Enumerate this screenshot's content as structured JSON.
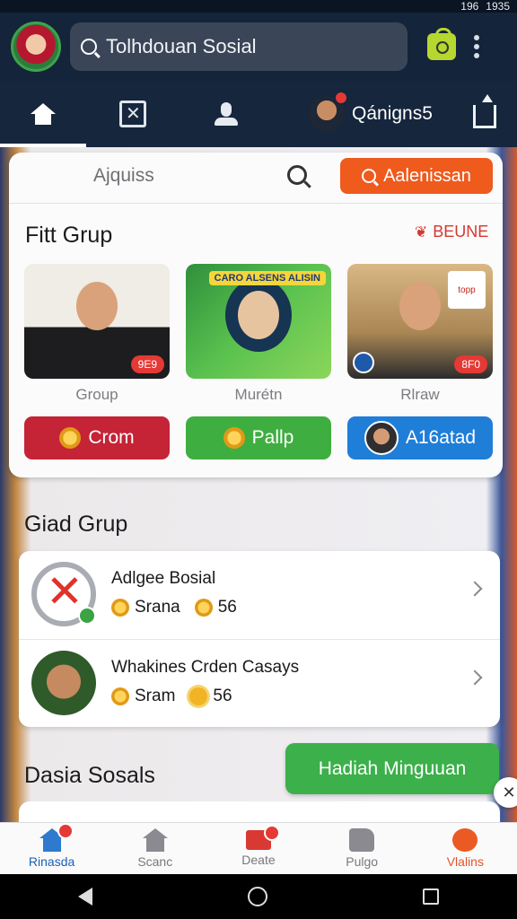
{
  "status_bar": {
    "battery": "196",
    "time": "1935"
  },
  "header": {
    "search_text": "Tolhdouan Sosial"
  },
  "nav_tabs": {
    "profile_name": "Qánigns5"
  },
  "featured": {
    "search_label": "Ajquiss",
    "action_button": "Aalenissan",
    "section_title": "Fitt Grup",
    "see_more": "BEUNE",
    "thumbnails": [
      {
        "caption": "Group",
        "badge": "9E9"
      },
      {
        "caption": "Murétn",
        "sign": "CARO ALSENS ALISIN"
      },
      {
        "caption": "Rlraw",
        "badge": "8F0",
        "sign": "topp"
      }
    ],
    "pills": [
      "Crom",
      "Pallp",
      "A16atad"
    ]
  },
  "groups": {
    "section_title": "Giad Grup",
    "items": [
      {
        "title": "Adlgee Bosial",
        "meta_name": "Srana",
        "count": "56"
      },
      {
        "title": "Whakines Crden Casays",
        "meta_name": "Sram",
        "count": "56"
      }
    ]
  },
  "social": {
    "section_title": "Dasia Sosals",
    "cta": "Hadiah Minguuan"
  },
  "bottom_nav": [
    {
      "label": "Rinasda",
      "icon": "home-icon"
    },
    {
      "label": "Scanc",
      "icon": "house-icon"
    },
    {
      "label": "Deate",
      "icon": "card-icon"
    },
    {
      "label": "Pulgo",
      "icon": "puzzle-icon"
    },
    {
      "label": "Vlalins",
      "icon": "fire-icon"
    }
  ],
  "colors": {
    "header": "#14243a",
    "accent_orange": "#ef5a1d",
    "accent_green": "#3fae40",
    "accent_red": "#c52336",
    "accent_blue": "#1f7ed8"
  }
}
